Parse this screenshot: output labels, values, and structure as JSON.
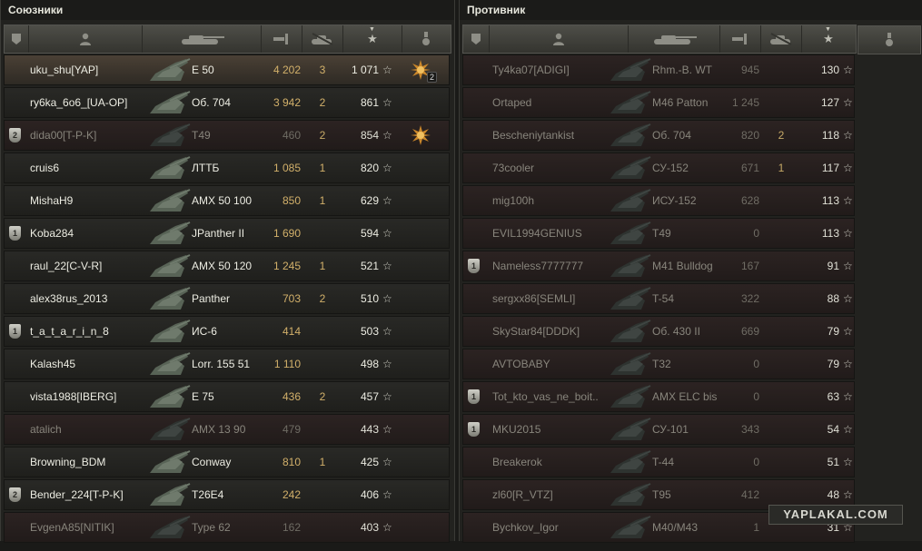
{
  "teams": [
    {
      "id": "left",
      "title": "Союзники",
      "players": [
        {
          "name": "uku_shu[YAP]",
          "tank": "E 50",
          "damage": "4 202",
          "kills": "3",
          "xp": "1 071",
          "state": "alive",
          "highlight": true,
          "medal": "ace-medal-icon",
          "medal_count": "2"
        },
        {
          "name": "ry6ka_6o6_[UA-OP]",
          "tank": "Об. 704",
          "damage": "3 942",
          "kills": "2",
          "xp": "861",
          "state": "alive"
        },
        {
          "name": "dida00[T-P-K]",
          "tank": "T49",
          "damage": "460",
          "kills": "2",
          "xp": "854",
          "state": "dead",
          "badge": "2",
          "medal": "medal-icon"
        },
        {
          "name": "cruis6",
          "tank": "ЛТТБ",
          "damage": "1 085",
          "kills": "1",
          "xp": "820",
          "state": "alive"
        },
        {
          "name": "MishaH9",
          "tank": "AMX 50 100",
          "damage": "850",
          "kills": "1",
          "xp": "629",
          "state": "alive"
        },
        {
          "name": "Koba284",
          "tank": "JPanther II",
          "damage": "1 690",
          "kills": "",
          "xp": "594",
          "state": "alive",
          "badge": "1"
        },
        {
          "name": "raul_22[C-V-R]",
          "tank": "AMX 50 120",
          "damage": "1 245",
          "kills": "1",
          "xp": "521",
          "state": "alive"
        },
        {
          "name": "alex38rus_2013",
          "tank": "Panther",
          "damage": "703",
          "kills": "2",
          "xp": "510",
          "state": "alive"
        },
        {
          "name": "t_a_t_a_r_i_n_8",
          "tank": "ИС-6",
          "damage": "414",
          "kills": "",
          "xp": "503",
          "state": "alive",
          "badge": "1"
        },
        {
          "name": "Kalash45",
          "tank": "Lorr. 155 51",
          "damage": "1 110",
          "kills": "",
          "xp": "498",
          "state": "alive"
        },
        {
          "name": "vista1988[IBERG]",
          "tank": "E 75",
          "damage": "436",
          "kills": "2",
          "xp": "457",
          "state": "alive"
        },
        {
          "name": "atalich",
          "tank": "AMX 13 90",
          "damage": "479",
          "kills": "",
          "xp": "443",
          "state": "dead"
        },
        {
          "name": "Browning_BDM",
          "tank": "Conway",
          "damage": "810",
          "kills": "1",
          "xp": "425",
          "state": "alive"
        },
        {
          "name": "Bender_224[T-P-K]",
          "tank": "T26E4",
          "damage": "242",
          "kills": "",
          "xp": "406",
          "state": "alive",
          "badge": "2"
        },
        {
          "name": "EvgenA85[NITIK]",
          "tank": "Type 62",
          "damage": "162",
          "kills": "",
          "xp": "403",
          "state": "dead"
        }
      ]
    },
    {
      "id": "right",
      "title": "Противник",
      "players": [
        {
          "name": "Ty4ka07[ADIGI]",
          "tank": "Rhm.-B. WT",
          "damage": "945",
          "kills": "",
          "xp": "130",
          "state": "dead"
        },
        {
          "name": "Ortaped",
          "tank": "M46 Patton",
          "damage": "1 245",
          "kills": "",
          "xp": "127",
          "state": "dead"
        },
        {
          "name": "Bescheniytankist",
          "tank": "Об. 704",
          "damage": "820",
          "kills": "2",
          "xp": "118",
          "state": "dead"
        },
        {
          "name": "73cooler",
          "tank": "СУ-152",
          "damage": "671",
          "kills": "1",
          "xp": "117",
          "state": "dead"
        },
        {
          "name": "mig100h",
          "tank": "ИСУ-152",
          "damage": "628",
          "kills": "",
          "xp": "113",
          "state": "dead"
        },
        {
          "name": "EVIL1994GENIUS",
          "tank": "T49",
          "damage": "0",
          "kills": "",
          "xp": "113",
          "state": "dead"
        },
        {
          "name": "Nameless7777777",
          "tank": "M41 Bulldog",
          "damage": "167",
          "kills": "",
          "xp": "91",
          "state": "dead",
          "badge": "1"
        },
        {
          "name": "sergxx86[SEMLI]",
          "tank": "T-54",
          "damage": "322",
          "kills": "",
          "xp": "88",
          "state": "dead"
        },
        {
          "name": "SkyStar84[DDDK]",
          "tank": "Об. 430 II",
          "damage": "669",
          "kills": "",
          "xp": "79",
          "state": "dead"
        },
        {
          "name": "AVTOBABY",
          "tank": "T32",
          "damage": "0",
          "kills": "",
          "xp": "79",
          "state": "dead"
        },
        {
          "name": "Tot_kto_vas_ne_boit..",
          "tank": "AMX ELC bis",
          "damage": "0",
          "kills": "",
          "xp": "63",
          "state": "dead",
          "badge": "1"
        },
        {
          "name": "MKU2015",
          "tank": "СУ-101",
          "damage": "343",
          "kills": "",
          "xp": "54",
          "state": "dead",
          "badge": "1"
        },
        {
          "name": "Breakerok",
          "tank": "T-44",
          "damage": "0",
          "kills": "",
          "xp": "51",
          "state": "dead"
        },
        {
          "name": "zl60[R_VTZ]",
          "tank": "T95",
          "damage": "412",
          "kills": "",
          "xp": "48",
          "state": "dead"
        },
        {
          "name": "Bychkov_Igor",
          "tank": "M40/M43",
          "damage": "1",
          "kills": "",
          "xp": "31",
          "state": "dead"
        }
      ]
    }
  ],
  "columns": [
    {
      "icon": "badge-icon"
    },
    {
      "icon": "player-icon"
    },
    {
      "icon": "tank-icon"
    },
    {
      "icon": "damage-icon"
    },
    {
      "icon": "kills-icon"
    },
    {
      "icon": "xp-star-icon",
      "sorted": true
    },
    {
      "icon": "medal-column-icon"
    }
  ],
  "watermark": "YAPLAKAL.COM",
  "colors": {
    "alive_text": "#ecece2",
    "dead_text": "#88857c",
    "damage_gold": "#d2b06a",
    "panel_bg": "#22221f"
  }
}
